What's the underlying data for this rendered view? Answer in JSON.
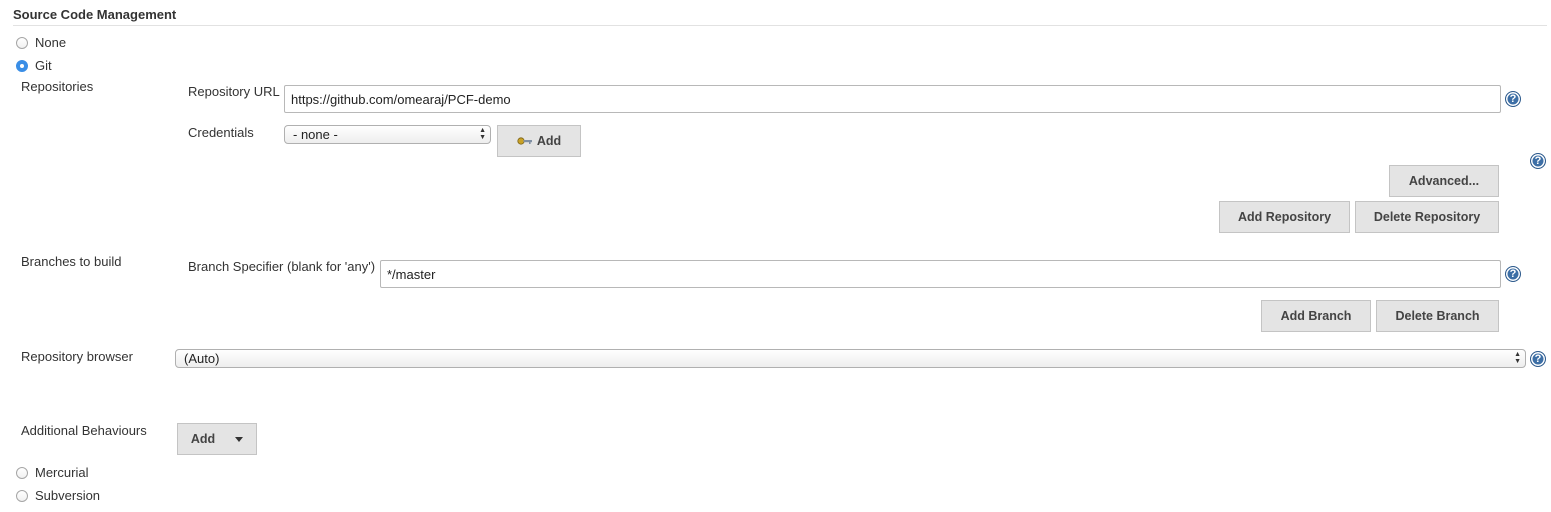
{
  "section": {
    "title": "Source Code Management"
  },
  "scm_options": {
    "none": "None",
    "git": "Git",
    "mercurial": "Mercurial",
    "subversion": "Subversion"
  },
  "selected_scm": "git",
  "repositories": {
    "label": "Repositories",
    "url_label": "Repository URL",
    "url_value": "https://github.com/omearaj/PCF-demo",
    "credentials_label": "Credentials",
    "credentials_value": "- none -",
    "add_credentials_label": "Add",
    "advanced_label": "Advanced...",
    "add_repository_label": "Add Repository",
    "delete_repository_label": "Delete Repository"
  },
  "branches": {
    "label": "Branches to build",
    "specifier_label": "Branch Specifier (blank for 'any')",
    "specifier_value": "*/master",
    "add_branch_label": "Add Branch",
    "delete_branch_label": "Delete Branch"
  },
  "repository_browser": {
    "label": "Repository browser",
    "value": "(Auto)"
  },
  "additional_behaviours": {
    "label": "Additional Behaviours",
    "add_label": "Add"
  },
  "help_glyph": "?",
  "colors": {
    "accent": "#3a8ee6",
    "button_bg": "#e4e4e4",
    "help_icon": "#3d6fa6"
  }
}
